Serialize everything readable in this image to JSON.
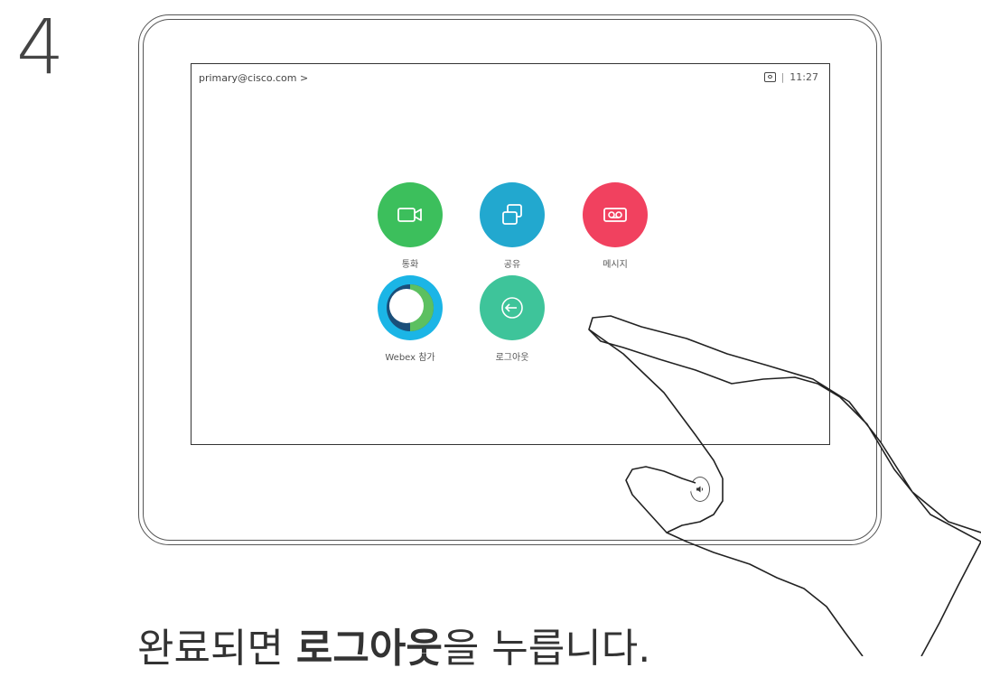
{
  "step_number": "4",
  "screen": {
    "account_label": "primary@cisco.com >",
    "time": "11:27",
    "separator": "|"
  },
  "tiles": {
    "call": {
      "label": "통화",
      "color": "#3cbf5c"
    },
    "share": {
      "label": "공유",
      "color": "#22a8cf"
    },
    "messages": {
      "label": "메시지",
      "color": "#f1415f"
    },
    "webex": {
      "label": "Webex 참가"
    },
    "logout": {
      "label": "로그아웃",
      "color": "#3ec49a"
    }
  },
  "caption": {
    "prefix": "완료되면 ",
    "bold": "로그아웃",
    "suffix": "을 누릅니다."
  }
}
